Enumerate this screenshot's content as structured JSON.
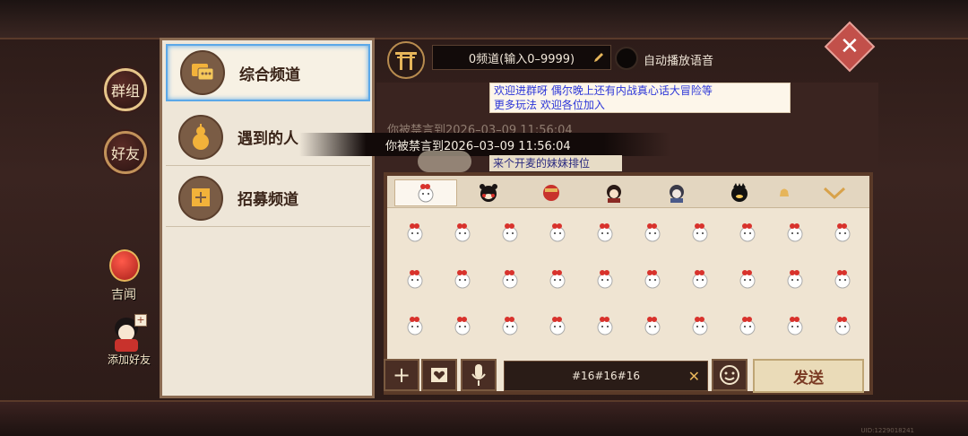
{
  "left_rail": {
    "group_label": "群组",
    "friends_label": "好友",
    "jiwen_label": "吉闻",
    "add_friend_label": "添加好友"
  },
  "channels": [
    {
      "label": "综合频道",
      "active": true
    },
    {
      "label": "遇到的人",
      "active": false
    },
    {
      "label": "招募频道",
      "active": false
    }
  ],
  "header": {
    "channel_input_text": "0频道(输入0–9999)",
    "auto_voice_label": "自动播放语音"
  },
  "chat": {
    "message_line1": "欢迎进群呀 偶尔晚上还有内战真心话大冒险等",
    "message_line2": "更多玩法 欢迎各位加入",
    "toast_faint": "你被禁言到2026–03–09 11:56:04",
    "toast_main": "你被禁言到2026–03–09 11:56:04",
    "faint_message": "来个开麦的妹妹排位"
  },
  "emoji_tabs": [
    "tab-1",
    "tab-2",
    "tab-3",
    "tab-4",
    "tab-5",
    "tab-6",
    "tab-7"
  ],
  "emoji_grid_rows": 3,
  "emoji_grid_cols": 10,
  "input_bar": {
    "message_value": "#16#16#16",
    "send_label": "发送"
  },
  "footer": {
    "uid_text": "UID:1229018241"
  },
  "colors": {
    "accent_blue": "#5ba8e8",
    "panel_bg": "#eee6d8",
    "message_blue": "#2c36d8"
  }
}
